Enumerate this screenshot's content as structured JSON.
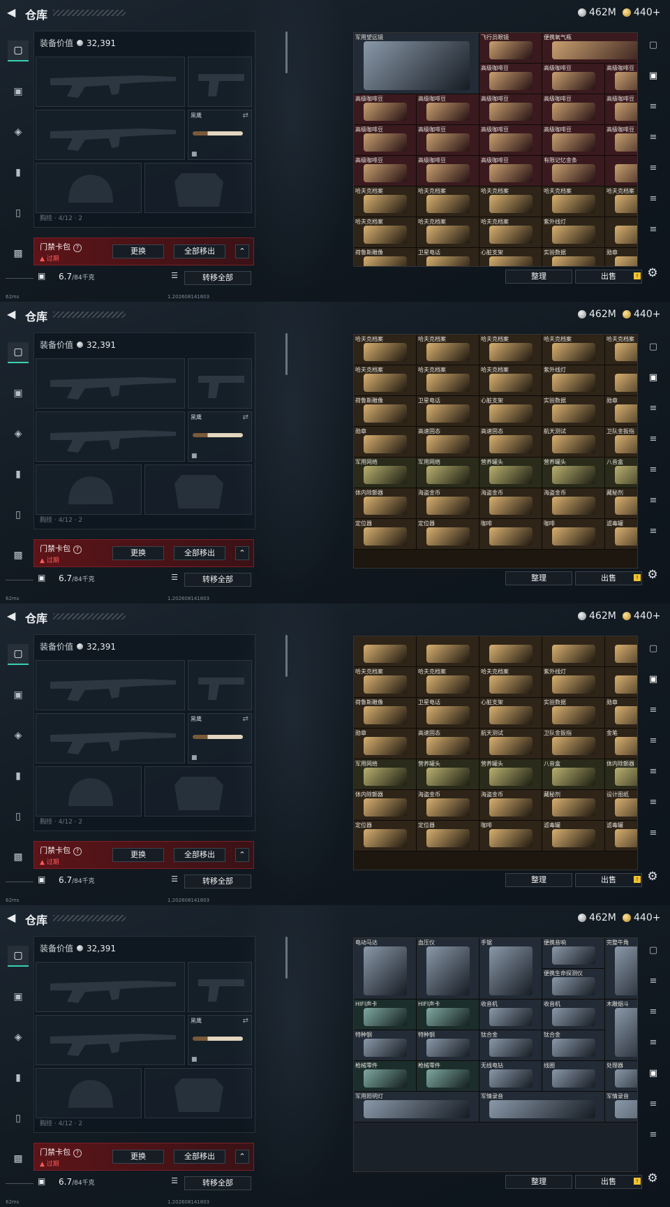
{
  "page": {
    "title": "仓库",
    "silver": "462M",
    "gold": "440+",
    "equip_label": "装备价值",
    "equip_value": "32,391",
    "slot_knife": "黑鹰",
    "slot_cutoff": "胸挂 · 4/12 · 2",
    "card_name": "门禁卡包",
    "card_help": "?",
    "card_expired": "过期",
    "btn_swap": "更换",
    "btn_remove_all": "全部移出",
    "weight": "6.7",
    "weight_unit": "/84千克",
    "btn_transfer": "转移全部",
    "btn_sort": "整理",
    "btn_sell": "出售",
    "ping": "62ms",
    "build": "1.202608141803",
    "warn_badge": "!",
    "icons": [
      "back-icon",
      "silver-coin-icon",
      "gold-coin-icon",
      "pistol-tab-icon",
      "vest-tab-icon",
      "armor-tab-icon",
      "backpack-tab-icon",
      "case-tab-icon",
      "briefcase-tab-icon",
      "lock-icon",
      "list-icon",
      "swap-icon",
      "settings-icon"
    ]
  },
  "frames": [
    {
      "tab": 1,
      "theme": "loot",
      "rows": [
        [
          {
            "name": "军用望远镜",
            "c": "slate",
            "span": 2,
            "h": 2
          },
          {
            "name": "飞行员眼镜",
            "c": "wine"
          },
          {
            "name": "便携氧气瓶",
            "c": "wine",
            "span": 2
          },
          {
            "name": "高级咖啡豆",
            "c": "wine"
          },
          {
            "name": "高级咖啡豆",
            "c": "wine"
          }
        ],
        [
          {
            "name": "高级咖啡豆",
            "c": "wine"
          },
          {
            "name": "高级咖啡豆",
            "c": "wine"
          },
          {
            "name": "高级咖啡豆",
            "c": "wine"
          },
          {
            "name": "",
            "c": "wine"
          }
        ],
        [
          {
            "name": "高级咖啡豆",
            "c": "wine"
          },
          {
            "name": "高级咖啡豆",
            "c": "wine"
          },
          {
            "name": "高级咖啡豆",
            "c": "wine"
          },
          {
            "name": "高级咖啡豆",
            "c": "wine"
          },
          {
            "name": "高级咖啡豆",
            "c": "wine"
          }
        ],
        [
          {
            "name": "高级咖啡豆",
            "c": "wine"
          },
          {
            "name": "高级咖啡豆",
            "c": "wine"
          },
          {
            "name": "高级咖啡豆",
            "c": "wine"
          },
          {
            "name": "高级咖啡豆",
            "c": "wine"
          },
          {
            "name": "高级咖啡豆",
            "c": "wine"
          }
        ],
        [
          {
            "name": "高级咖啡豆",
            "c": "wine"
          },
          {
            "name": "高级咖啡豆",
            "c": "wine"
          },
          {
            "name": "高级咖啡豆",
            "c": "wine"
          },
          {
            "name": "有限记忆金条",
            "c": "wine"
          },
          {
            "name": "",
            "c": "wine"
          }
        ],
        [
          {
            "name": "哈夫克档案",
            "c": "brown"
          },
          {
            "name": "哈夫克档案",
            "c": "brown"
          },
          {
            "name": "哈夫克档案",
            "c": "brown"
          },
          {
            "name": "哈夫克档案",
            "c": "brown"
          },
          {
            "name": "哈夫克档案",
            "c": "brown"
          }
        ],
        [
          {
            "name": "哈夫克档案",
            "c": "brown"
          },
          {
            "name": "哈夫克档案",
            "c": "brown"
          },
          {
            "name": "哈夫克档案",
            "c": "brown"
          },
          {
            "name": "紫外线灯",
            "c": "brown"
          },
          {
            "name": "",
            "c": "brown"
          }
        ],
        [
          {
            "name": "荷鲁斯雕像",
            "c": "brown"
          },
          {
            "name": "卫星电话",
            "c": "brown"
          },
          {
            "name": "心脏支架",
            "c": "brown"
          },
          {
            "name": "实验数据",
            "c": "brown"
          },
          {
            "name": "勋章",
            "c": "brown"
          }
        ]
      ]
    },
    {
      "tab": 1,
      "theme": "loot",
      "rows": [
        [
          {
            "name": "哈夫克档案",
            "c": "brown"
          },
          {
            "name": "哈夫克档案",
            "c": "brown"
          },
          {
            "name": "哈夫克档案",
            "c": "brown"
          },
          {
            "name": "哈夫克档案",
            "c": "brown"
          },
          {
            "name": "哈夫克档案",
            "c": "brown"
          }
        ],
        [
          {
            "name": "哈夫克档案",
            "c": "brown"
          },
          {
            "name": "哈夫克档案",
            "c": "brown"
          },
          {
            "name": "哈夫克档案",
            "c": "brown"
          },
          {
            "name": "紫外线灯",
            "c": "brown"
          },
          {
            "name": "",
            "c": "brown"
          }
        ],
        [
          {
            "name": "荷鲁斯雕像",
            "c": "brown"
          },
          {
            "name": "卫星电话",
            "c": "brown"
          },
          {
            "name": "心脏支架",
            "c": "brown"
          },
          {
            "name": "实验数据",
            "c": "brown"
          },
          {
            "name": "勋章",
            "c": "brown"
          }
        ],
        [
          {
            "name": "勋章",
            "c": "brown"
          },
          {
            "name": "高速固态",
            "c": "brown"
          },
          {
            "name": "高速固态",
            "c": "brown"
          },
          {
            "name": "航天测试",
            "c": "brown"
          },
          {
            "name": "卫队金扳指",
            "c": "brown"
          }
        ],
        [
          {
            "name": "军用网络",
            "c": "olive"
          },
          {
            "name": "军用网络",
            "c": "olive"
          },
          {
            "name": "营养罐头",
            "c": "olive"
          },
          {
            "name": "营养罐头",
            "c": "olive"
          },
          {
            "name": "八音盒",
            "c": "olive"
          }
        ],
        [
          {
            "name": "体内除颤器",
            "c": "brown"
          },
          {
            "name": "海盗金币",
            "c": "brown"
          },
          {
            "name": "海盗金币",
            "c": "brown"
          },
          {
            "name": "海盗金币",
            "c": "brown"
          },
          {
            "name": "藏秘剂",
            "c": "brown"
          }
        ],
        [
          {
            "name": "定位器",
            "c": "brown"
          },
          {
            "name": "定位器",
            "c": "brown"
          },
          {
            "name": "咖啡",
            "c": "brown"
          },
          {
            "name": "咖啡",
            "c": "brown"
          },
          {
            "name": "滤毒罐",
            "c": "brown"
          }
        ]
      ]
    },
    {
      "tab": 1,
      "theme": "loot",
      "rows": [
        [
          {
            "name": "",
            "c": "brown"
          },
          {
            "name": "",
            "c": "brown"
          },
          {
            "name": "",
            "c": "brown"
          },
          {
            "name": "",
            "c": "brown"
          },
          {
            "name": "",
            "c": "brown"
          }
        ],
        [
          {
            "name": "哈夫克档案",
            "c": "brown"
          },
          {
            "name": "哈夫克档案",
            "c": "brown"
          },
          {
            "name": "哈夫克档案",
            "c": "brown"
          },
          {
            "name": "紫外线灯",
            "c": "brown"
          },
          {
            "name": "",
            "c": "brown"
          }
        ],
        [
          {
            "name": "荷鲁斯雕像",
            "c": "brown"
          },
          {
            "name": "卫星电话",
            "c": "brown"
          },
          {
            "name": "心脏支架",
            "c": "brown"
          },
          {
            "name": "实验数据",
            "c": "brown"
          },
          {
            "name": "勋章",
            "c": "brown"
          }
        ],
        [
          {
            "name": "勋章",
            "c": "brown"
          },
          {
            "name": "高速固态",
            "c": "brown"
          },
          {
            "name": "航天测试",
            "c": "brown"
          },
          {
            "name": "卫队金扳指",
            "c": "brown"
          },
          {
            "name": "金笔",
            "c": "brown"
          }
        ],
        [
          {
            "name": "军用网络",
            "c": "olive"
          },
          {
            "name": "营养罐头",
            "c": "olive"
          },
          {
            "name": "营养罐头",
            "c": "olive"
          },
          {
            "name": "八音盒",
            "c": "olive"
          },
          {
            "name": "体内除颤器",
            "c": "olive"
          }
        ],
        [
          {
            "name": "体内除颤器",
            "c": "brown"
          },
          {
            "name": "海盗金币",
            "c": "brown"
          },
          {
            "name": "海盗金币",
            "c": "brown"
          },
          {
            "name": "藏秘剂",
            "c": "brown"
          },
          {
            "name": "设计图纸",
            "c": "brown"
          }
        ],
        [
          {
            "name": "定位器",
            "c": "brown"
          },
          {
            "name": "定位器",
            "c": "brown"
          },
          {
            "name": "咖啡",
            "c": "brown"
          },
          {
            "name": "滤毒罐",
            "c": "brown"
          },
          {
            "name": "滤毒罐",
            "c": "brown"
          }
        ]
      ]
    },
    {
      "tab": 4,
      "theme": "tools",
      "rows": [
        [
          {
            "name": "电动马达",
            "c": "slate",
            "h": 2
          },
          {
            "name": "血压仪",
            "c": "slate",
            "h": 2
          },
          {
            "name": "手锯",
            "c": "slate",
            "h": 2
          },
          {
            "name": "便携音响",
            "c": "slate"
          },
          {
            "name": "完整牛角",
            "c": "slate",
            "h": 2
          }
        ],
        [
          {
            "name": "便携生命探测仪",
            "c": "slate"
          }
        ],
        [
          {
            "name": "HIFI声卡",
            "c": "teal"
          },
          {
            "name": "HIFI声卡",
            "c": "teal"
          },
          {
            "name": "收音机",
            "c": "slate"
          },
          {
            "name": "收音机",
            "c": "slate"
          },
          {
            "name": "木雕烟斗",
            "c": "slate",
            "h": 2
          }
        ],
        [
          {
            "name": "特种钢",
            "c": "slate"
          },
          {
            "name": "特种钢",
            "c": "slate"
          },
          {
            "name": "钛合金",
            "c": "slate"
          },
          {
            "name": "钛合金",
            "c": "slate"
          }
        ],
        [
          {
            "name": "枪械零件",
            "c": "teal"
          },
          {
            "name": "枪械零件",
            "c": "teal"
          },
          {
            "name": "无线电钻",
            "c": "slate"
          },
          {
            "name": "线圈",
            "c": "slate"
          },
          {
            "name": "处理器",
            "c": "slate"
          }
        ],
        [
          {
            "name": "军用照明灯",
            "c": "slate",
            "span": 2
          },
          {
            "name": "军情录音",
            "c": "slate",
            "span": 2
          },
          {
            "name": "军情录音",
            "c": "slate",
            "span": 2
          }
        ]
      ]
    }
  ]
}
